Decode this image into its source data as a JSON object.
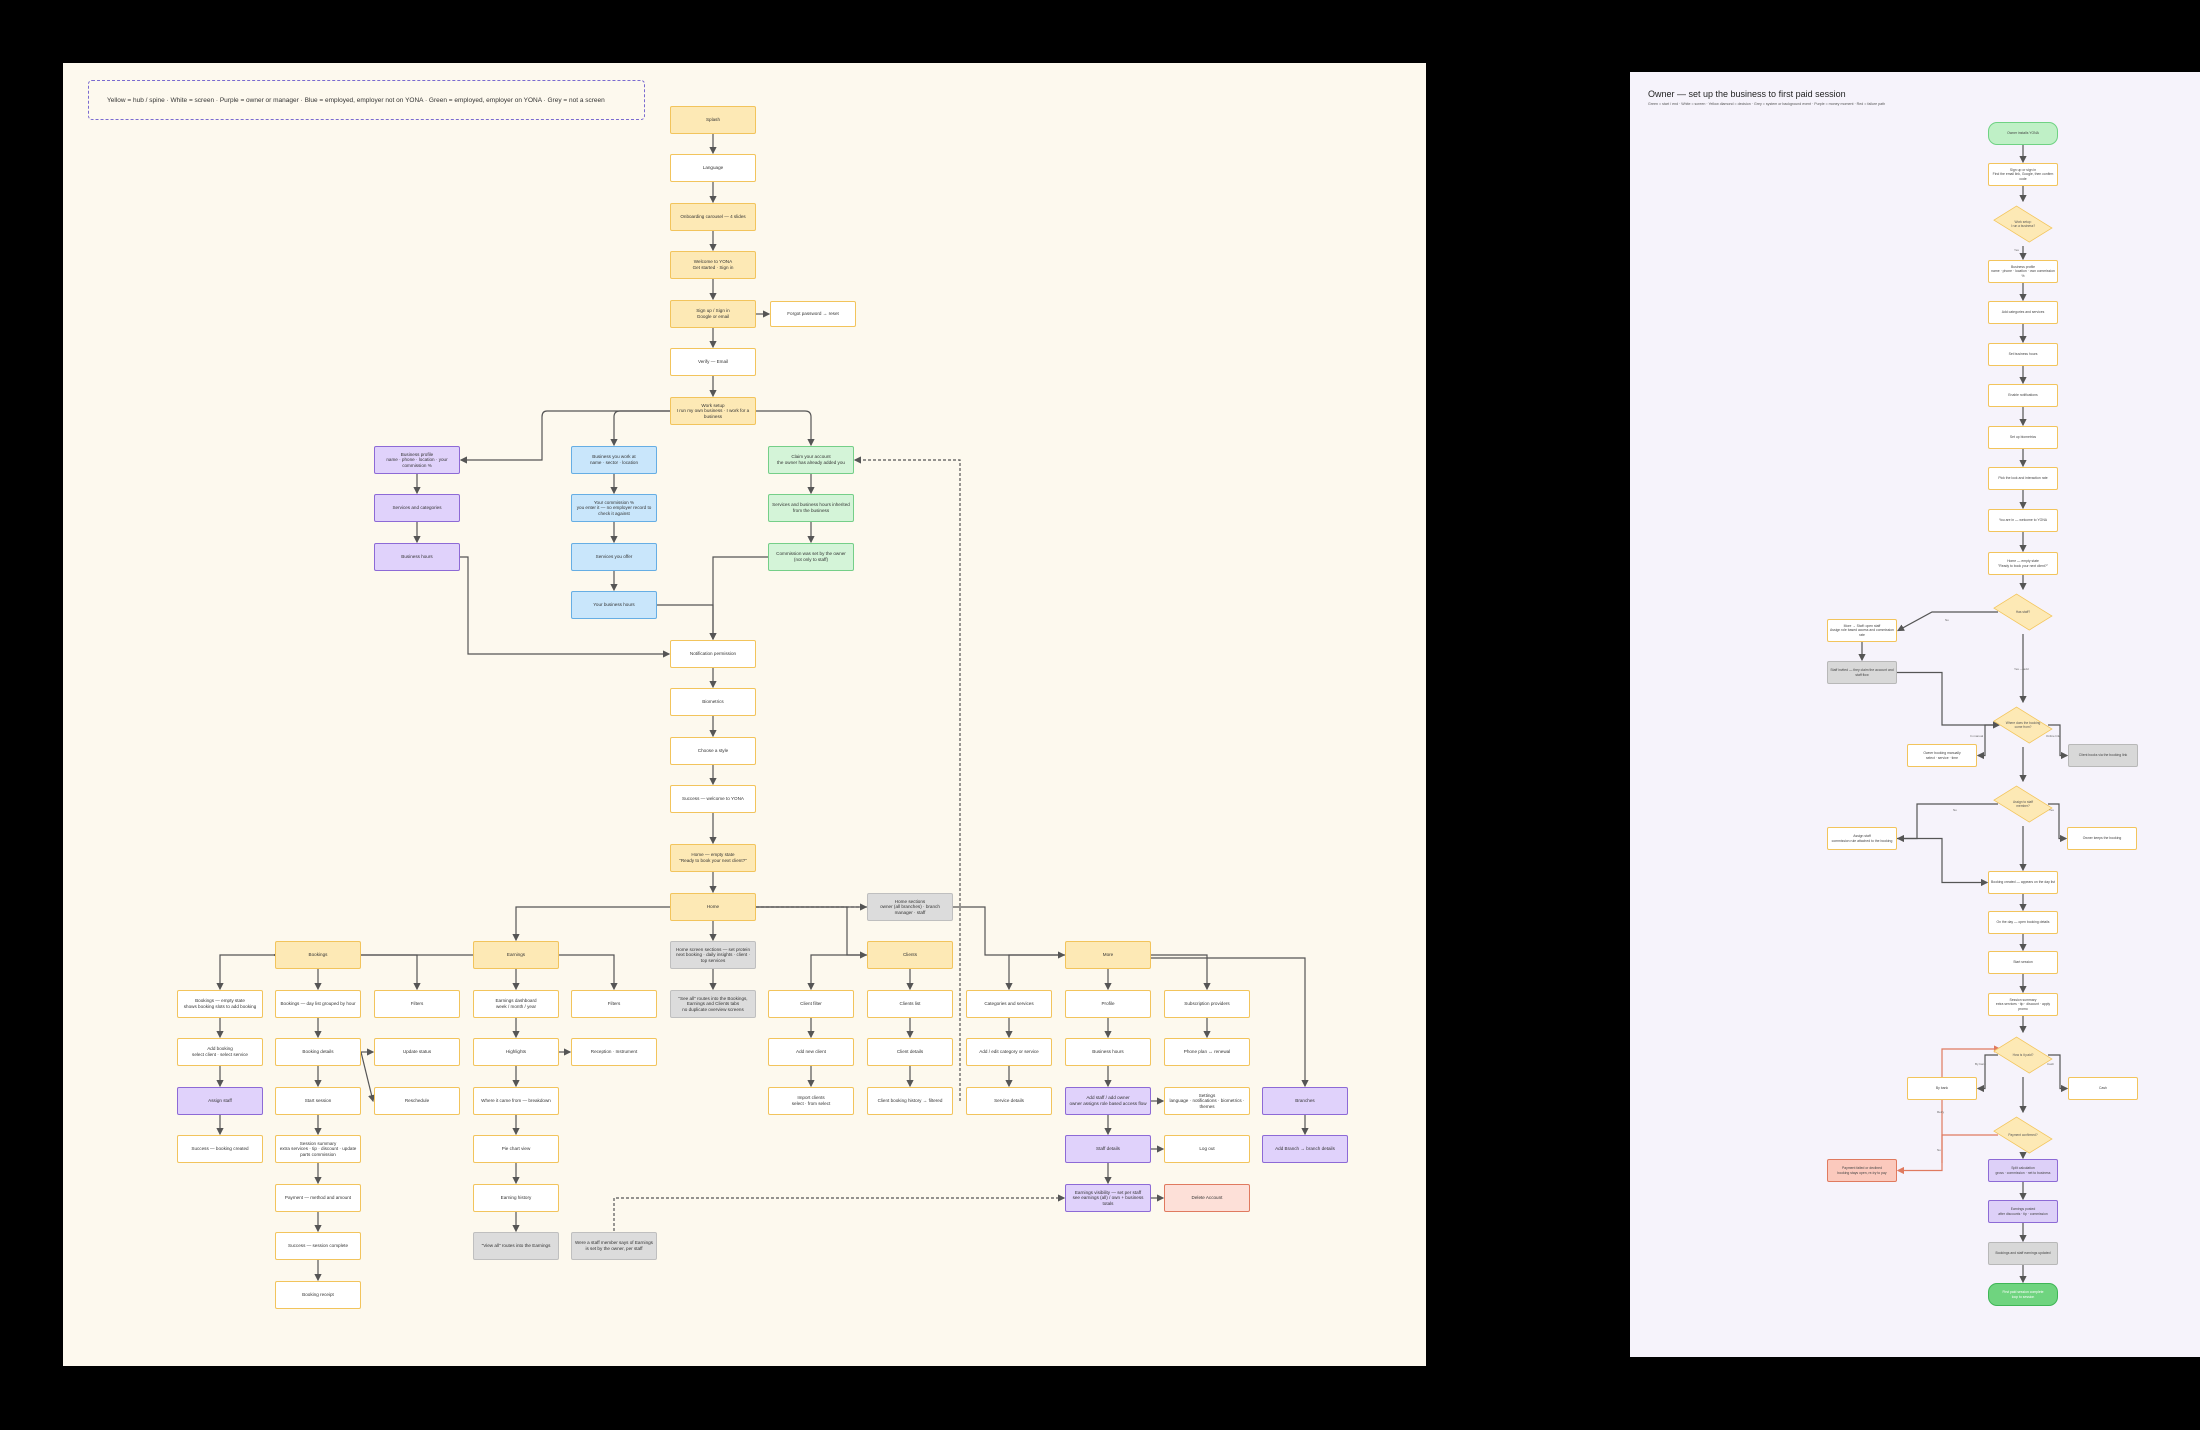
{
  "left": {
    "legend": "Yellow = hub / spine  ·  White = screen  ·  Purple = owner or manager  ·  Blue = employed, employer not on YONA  ·  Green = employed, employer on YONA  ·  Grey = not a screen",
    "nodes": [
      {
        "id": "splash",
        "text": "Splash",
        "c": "y"
      },
      {
        "id": "language",
        "text": "Language",
        "c": "w"
      },
      {
        "id": "onboarding",
        "text": "Onboarding carousel — 4 slides",
        "c": "y"
      },
      {
        "id": "welcome",
        "text": "Welcome to YONA\nGet started  ·  Sign in",
        "c": "y"
      },
      {
        "id": "signup",
        "text": "Sign up / Sign in\nGoogle or email",
        "c": "y"
      },
      {
        "id": "forgot",
        "text": "Forgot password → reset",
        "c": "w"
      },
      {
        "id": "verify",
        "text": "Verify — Email",
        "c": "w"
      },
      {
        "id": "worksetup",
        "text": "Work setup\nI run my own business  ·  I work for a business",
        "c": "y"
      },
      {
        "id": "bizprofile",
        "text": "Business profile\nname · phone · location · your commission %",
        "c": "p"
      },
      {
        "id": "services",
        "text": "Services and categories",
        "c": "p"
      },
      {
        "id": "bizhours",
        "text": "Business hours",
        "c": "p"
      },
      {
        "id": "bizwork",
        "text": "Business you work at\nname · sector · location",
        "c": "b"
      },
      {
        "id": "commission",
        "text": "Your commission %\nyou enter it — no employer record to check it against",
        "c": "b"
      },
      {
        "id": "servicesoffer",
        "text": "Services you offer",
        "c": "b"
      },
      {
        "id": "yourhours",
        "text": "Your business hours",
        "c": "b"
      },
      {
        "id": "claimaccount",
        "text": "Claim your account\nthe owner has already added you",
        "c": "g"
      },
      {
        "id": "servicesinherit",
        "text": "Services and business hours inherited from the business",
        "c": "g"
      },
      {
        "id": "commissionset",
        "text": "Commission was set by the owner (not only to staff)",
        "c": "g"
      },
      {
        "id": "notif",
        "text": "Notification permission",
        "c": "w"
      },
      {
        "id": "biometrics",
        "text": "Biometrics",
        "c": "w"
      },
      {
        "id": "chooselook",
        "text": "Choose a style",
        "c": "w"
      },
      {
        "id": "success",
        "text": "Success — welcome to YONA",
        "c": "w"
      },
      {
        "id": "homeempty",
        "text": "Home — empty state\n\"Ready to book your next client?\"",
        "c": "y"
      },
      {
        "id": "home",
        "text": "Home",
        "c": "y"
      },
      {
        "id": "homesections",
        "text": "Home sections\nowner (all branches) · branch manager · staff",
        "c": "gr"
      },
      {
        "id": "homescreen",
        "text": "Home screen sections — set protein next booking · daily insights · client · top services",
        "c": "gr"
      },
      {
        "id": "seeall",
        "text": "\"See all\" routes into the Bookings, Earnings and Clients tabs\nno duplicate overview screens",
        "c": "gr"
      },
      {
        "id": "bookings",
        "text": "Bookings",
        "c": "y"
      },
      {
        "id": "earnings",
        "text": "Earnings",
        "c": "y"
      },
      {
        "id": "clients",
        "text": "Clients",
        "c": "y"
      },
      {
        "id": "more",
        "text": "More",
        "c": "y"
      },
      {
        "id": "bk_empty",
        "text": "Bookings — empty state\nshows booking slots to add booking",
        "c": "w"
      },
      {
        "id": "bk_day",
        "text": "Bookings — day list grouped by hour",
        "c": "w"
      },
      {
        "id": "bk_filters",
        "text": "Filters",
        "c": "w"
      },
      {
        "id": "bk_add",
        "text": "Add booking\nselect client · select service",
        "c": "w"
      },
      {
        "id": "bk_details",
        "text": "Booking details",
        "c": "w"
      },
      {
        "id": "bk_update",
        "text": "Update status",
        "c": "w"
      },
      {
        "id": "bk_assign",
        "text": "Assign staff",
        "c": "p"
      },
      {
        "id": "bk_start",
        "text": "Start session",
        "c": "w"
      },
      {
        "id": "bk_reschedule",
        "text": "Reschedule",
        "c": "w"
      },
      {
        "id": "bk_success",
        "text": "Success — booking created",
        "c": "w"
      },
      {
        "id": "bk_summary",
        "text": "Session summary\nextra services · tip · discount · update parts commission",
        "c": "w"
      },
      {
        "id": "bk_payment",
        "text": "Payment — method and amount",
        "c": "w"
      },
      {
        "id": "bk_done",
        "text": "Success — session complete",
        "c": "w"
      },
      {
        "id": "bk_receipt",
        "text": "Booking receipt",
        "c": "w"
      },
      {
        "id": "er_dashboard",
        "text": "Earnings dashboard\nweek / month / year",
        "c": "w"
      },
      {
        "id": "er_filters",
        "text": "Filters",
        "c": "w"
      },
      {
        "id": "er_highlights",
        "text": "Highlights",
        "c": "w"
      },
      {
        "id": "er_reception",
        "text": "Reception · Instrument",
        "c": "w"
      },
      {
        "id": "er_where",
        "text": "Where it came from — breakdown",
        "c": "w"
      },
      {
        "id": "er_pie",
        "text": "Pie chart view",
        "c": "w"
      },
      {
        "id": "er_history",
        "text": "Earning history",
        "c": "w"
      },
      {
        "id": "er_viewall",
        "text": "\"View all\" routes into the Earnings",
        "c": "gr"
      },
      {
        "id": "er_staff",
        "text": "Were a staff member says of Earnings is set by the owner, per staff",
        "c": "gr"
      },
      {
        "id": "cl_filter",
        "text": "Client filter",
        "c": "w"
      },
      {
        "id": "cl_list",
        "text": "Clients list",
        "c": "w"
      },
      {
        "id": "cl_add",
        "text": "Add new client",
        "c": "w"
      },
      {
        "id": "cl_details",
        "text": "Client details",
        "c": "w"
      },
      {
        "id": "cl_import",
        "text": "Import clients\nselect · from select",
        "c": "w"
      },
      {
        "id": "cl_history",
        "text": "Client booking history → filtered",
        "c": "w"
      },
      {
        "id": "mo_categories",
        "text": "Categories and services",
        "c": "w"
      },
      {
        "id": "mo_profile",
        "text": "Profile",
        "c": "w"
      },
      {
        "id": "mo_subscription",
        "text": "Subscription providers",
        "c": "w"
      },
      {
        "id": "mo_addedit",
        "text": "Add / edit category or service",
        "c": "w"
      },
      {
        "id": "mo_bizhours",
        "text": "Business hours",
        "c": "w"
      },
      {
        "id": "mo_phone",
        "text": "Phone plan ↔ renewal",
        "c": "w"
      },
      {
        "id": "mo_service",
        "text": "Service details",
        "c": "w"
      },
      {
        "id": "mo_addstaff",
        "text": "Add staff / add owner\nowner assigns role based access flow",
        "c": "p"
      },
      {
        "id": "mo_settings",
        "text": "Settings\nlanguage · notifications · biometrics · themes",
        "c": "w"
      },
      {
        "id": "mo_branches",
        "text": "Branches",
        "c": "p"
      },
      {
        "id": "mo_staffdetails",
        "text": "Staff details",
        "c": "p"
      },
      {
        "id": "mo_logout",
        "text": "Log out",
        "c": "w"
      },
      {
        "id": "mo_addbranch",
        "text": "Add Branch → branch details",
        "c": "p"
      },
      {
        "id": "mo_earnings",
        "text": "Earnings visibility — set per staff\nsee earnings (all) / own + business totals",
        "c": "p"
      },
      {
        "id": "mo_delete",
        "text": "Delete Account",
        "c": "r"
      }
    ]
  },
  "right": {
    "title": "Owner — set up the business to first paid session",
    "subtitle": "Green = start / end  ·  White = screen  ·  Yellow diamond = decision  ·  Grey = system or background event  ·  Purple = money moment  ·  Red = failure path",
    "nodes": [
      {
        "id": "r_start",
        "text": "Owner installs YONA",
        "c": "rg"
      },
      {
        "id": "r_signup",
        "text": "Sign up or sign in\nFind the email link, Google, then confirm code",
        "c": "rw"
      },
      {
        "id": "r_d1",
        "text": "Work setup:\nI run a business?",
        "c": "d"
      },
      {
        "id": "r_profile",
        "text": "Business profile\nname · phone · location · own commission %",
        "c": "rw"
      },
      {
        "id": "r_cats",
        "text": "Add categories and services",
        "c": "rw"
      },
      {
        "id": "r_hours",
        "text": "Set business hours",
        "c": "rw"
      },
      {
        "id": "r_notif",
        "text": "Enable notifications",
        "c": "rw"
      },
      {
        "id": "r_bio",
        "text": "Set up biometrics",
        "c": "rw"
      },
      {
        "id": "r_style",
        "text": "Pick the look and interaction rate",
        "c": "rw"
      },
      {
        "id": "r_success",
        "text": "You are in — welcome to YONA",
        "c": "rw"
      },
      {
        "id": "r_home",
        "text": "Home — empty state\n\"Ready to book your next client?\"",
        "c": "rw"
      },
      {
        "id": "r_d2",
        "text": "Has staff?",
        "c": "d"
      },
      {
        "id": "r_more",
        "text": "More → Staff: open staff\nAssign role based access and commission rate",
        "c": "rw"
      },
      {
        "id": "r_staffinv",
        "text": "Staff invited — they claim the account and staff flow",
        "c": "rgr"
      },
      {
        "id": "r_d3",
        "text": "Where does the booking come from?",
        "c": "d"
      },
      {
        "id": "r_manual",
        "text": "Owner booking manually\nselect · service · time",
        "c": "rw"
      },
      {
        "id": "r_online",
        "text": "Client books via the booking link",
        "c": "rgr"
      },
      {
        "id": "r_d4",
        "text": "Assign to staff\nmember?",
        "c": "d"
      },
      {
        "id": "r_assign",
        "text": "Assign staff\ncommission rule attached to the booking",
        "c": "rw"
      },
      {
        "id": "r_itself",
        "text": "Owner keeps the booking",
        "c": "rw"
      },
      {
        "id": "r_booked",
        "text": "Booking created — appears on the day list",
        "c": "rw"
      },
      {
        "id": "r_dayof",
        "text": "On the day — open booking details",
        "c": "rw"
      },
      {
        "id": "r_startsess",
        "text": "Start session",
        "c": "rw"
      },
      {
        "id": "r_summary",
        "text": "Session summary\nextra services · tip · discount · apply promo",
        "c": "rw"
      },
      {
        "id": "r_d5",
        "text": "How is it paid?",
        "c": "d"
      },
      {
        "id": "r_card",
        "text": "By bank",
        "c": "rw"
      },
      {
        "id": "r_cash",
        "text": "Cash",
        "c": "rw"
      },
      {
        "id": "r_d6",
        "text": "Payment confirmed?",
        "c": "d"
      },
      {
        "id": "r_fail",
        "text": "Payment failed or declined\nbooking stays open, re-try to pay",
        "c": "rr"
      },
      {
        "id": "r_split",
        "text": "Split calculation\ngross · commission · net to business",
        "c": "rp"
      },
      {
        "id": "r_earnings",
        "text": "Earnings posted\nafter discounts · tip · commission",
        "c": "rp"
      },
      {
        "id": "r_receipt",
        "text": "Bookings and staff earnings updated",
        "c": "rgr"
      },
      {
        "id": "r_end",
        "text": "First paid session complete\nloop to session",
        "c": "rgd"
      }
    ],
    "edge_labels": {
      "yes": "Yes",
      "no": "No",
      "yes_no": "Yes — add",
      "manual": "In manual",
      "online": "Online link",
      "card": "By bank",
      "cash": "Cash",
      "retry": "Retry"
    }
  }
}
